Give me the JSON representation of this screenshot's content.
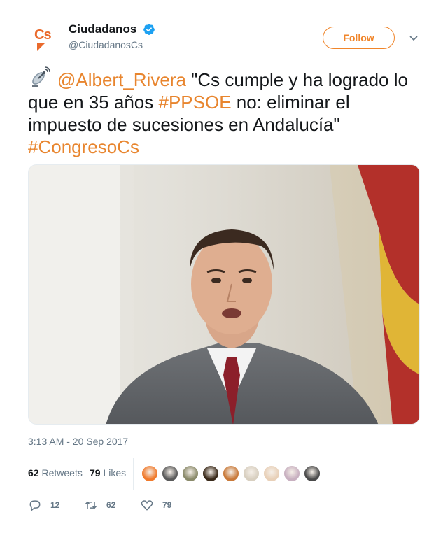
{
  "account": {
    "display_name": "Ciudadanos",
    "handle": "@CiudadanosCs",
    "verified": true,
    "avatar_text": "Cs",
    "brand_color": "#ea6a2c"
  },
  "follow_label": "Follow",
  "tweet": {
    "mention": "@Albert_Rivera",
    "text_part1": " \"Cs cumple y ha logrado lo que en 35 años ",
    "hashtag1": "#PPSOE",
    "text_part2": " no: eliminar el impuesto de sucesiones en Andalucía\" ",
    "hashtag2": "#CongresoCs",
    "link_color": "#e8852e"
  },
  "timestamp": "3:13 AM - 20 Sep 2017",
  "stats": {
    "retweets_count": "62",
    "retweets_label": "Retweets",
    "likes_count": "79",
    "likes_label": "Likes"
  },
  "actions": {
    "replies": "12",
    "retweets": "62",
    "likes": "79"
  },
  "likers": [
    {
      "color": "#f07a2c"
    },
    {
      "color": "#5a5a5a"
    },
    {
      "color": "#8a8a6a"
    },
    {
      "color": "#3a2a1a"
    },
    {
      "color": "#c97a3a"
    },
    {
      "color": "#d8cfc0"
    },
    {
      "color": "#e8d0b8"
    },
    {
      "color": "#c8b0c0"
    },
    {
      "color": "#4a4a4a"
    }
  ]
}
